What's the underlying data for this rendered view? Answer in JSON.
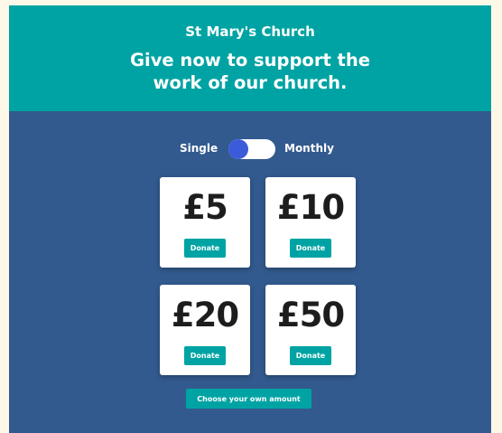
{
  "header": {
    "church_name": "St Mary's Church",
    "headline_line1": "Give now to support the",
    "headline_line2": "work of our church."
  },
  "frequency_toggle": {
    "left_label": "Single",
    "right_label": "Monthly",
    "selected": "Single"
  },
  "donation_options": [
    {
      "amount": "£5",
      "button_label": "Donate"
    },
    {
      "amount": "£10",
      "button_label": "Donate"
    },
    {
      "amount": "£20",
      "button_label": "Donate"
    },
    {
      "amount": "£50",
      "button_label": "Donate"
    }
  ],
  "custom_amount_button": "Choose your own amount",
  "colors": {
    "page_background": "#fdf8e8",
    "header_teal": "#00a3a3",
    "panel_blue": "#325a8e",
    "toggle_knob": "#3b5bdb",
    "card_white": "#ffffff",
    "amount_text": "#1d1d1d"
  }
}
